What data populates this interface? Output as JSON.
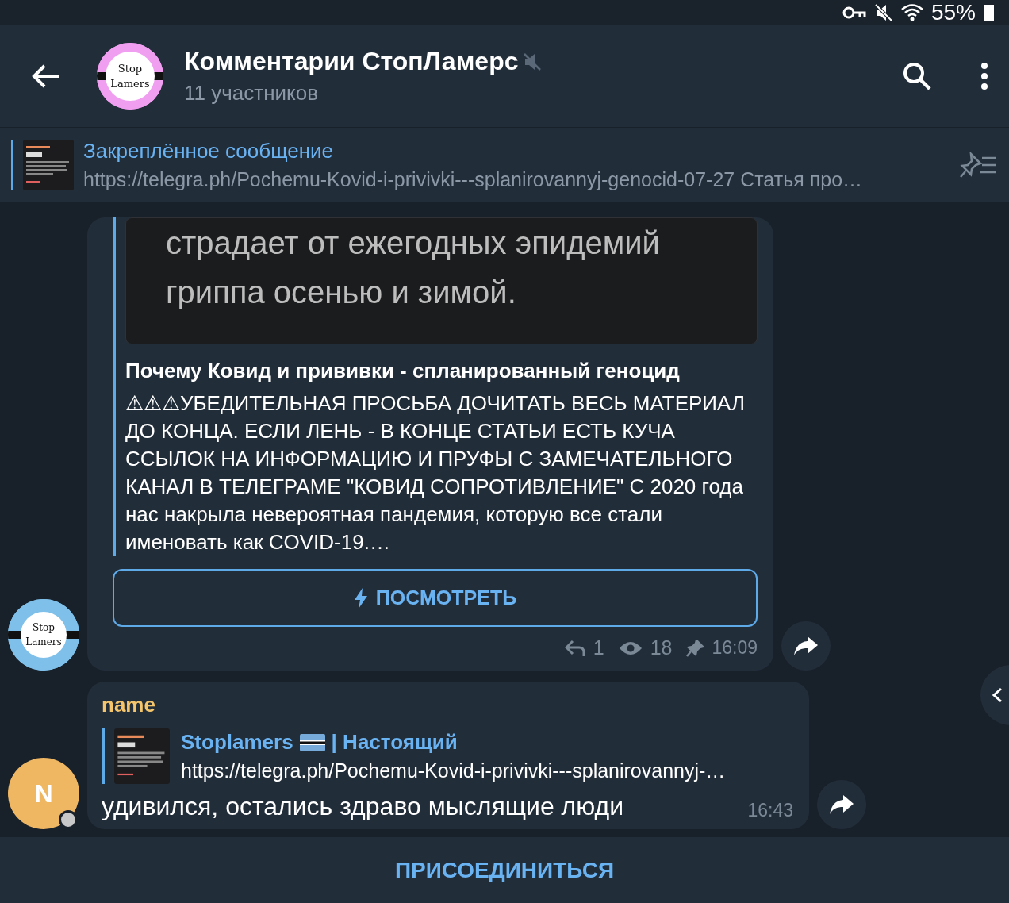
{
  "status_bar": {
    "battery": "55%"
  },
  "header": {
    "avatar_text": [
      "Stop",
      "Lamers"
    ],
    "title": "Комментарии СтопЛамерс",
    "muted": true,
    "subtitle": "11 участников"
  },
  "pinned": {
    "title": "Закреплённое сообщение",
    "text": "https://telegra.ph/Pochemu-Kovid-i-privivki---splanirovannyj-genocid-07-27  Статья про…"
  },
  "messages": [
    {
      "kind": "post",
      "avatar_text": [
        "Stop",
        "Lamers"
      ],
      "image_text": [
        "страдает от ежегодных эпидемий",
        "гриппа осенью и зимой."
      ],
      "link_title": "Почему Ковид и прививки - спланированный геноцид",
      "description": "⚠⚠⚠УБЕДИТЕЛЬНАЯ ПРОСЬБА ДОЧИТАТЬ ВЕСЬ МАТЕРИАЛ ДО КОНЦА. ЕСЛИ ЛЕНЬ - В КОНЦЕ СТАТЬИ ЕСТЬ КУЧА ССЫЛОК НА ИНФОРМАЦИЮ И ПРУФЫ С ЗАМЕЧАТЕЛЬНОГО КАНАЛ В ТЕЛЕГРАМЕ \"КОВИД СОПРОТИВЛЕНИЕ\" С 2020 года нас накрыла невероятная пандемия, которую все стали именовать как COVID-19.…",
      "button": "ПОСМОТРЕТЬ",
      "replies": "1",
      "views": "18",
      "pinned": true,
      "time": "16:09"
    },
    {
      "kind": "comment",
      "avatar_letter": "N",
      "online": true,
      "author": "name",
      "color": "#f5c56b",
      "reply_title": "Stoplamers",
      "reply_title_rest": "| Настоящий",
      "reply_text": "https://telegra.ph/Pochemu-Kovid-i-privivki---splanirovannyj-…",
      "text": "удивился, остались здраво мыслящие люди",
      "time": "16:43"
    }
  ],
  "join_button": "ПРИСОЕДИНИТЬСЯ"
}
